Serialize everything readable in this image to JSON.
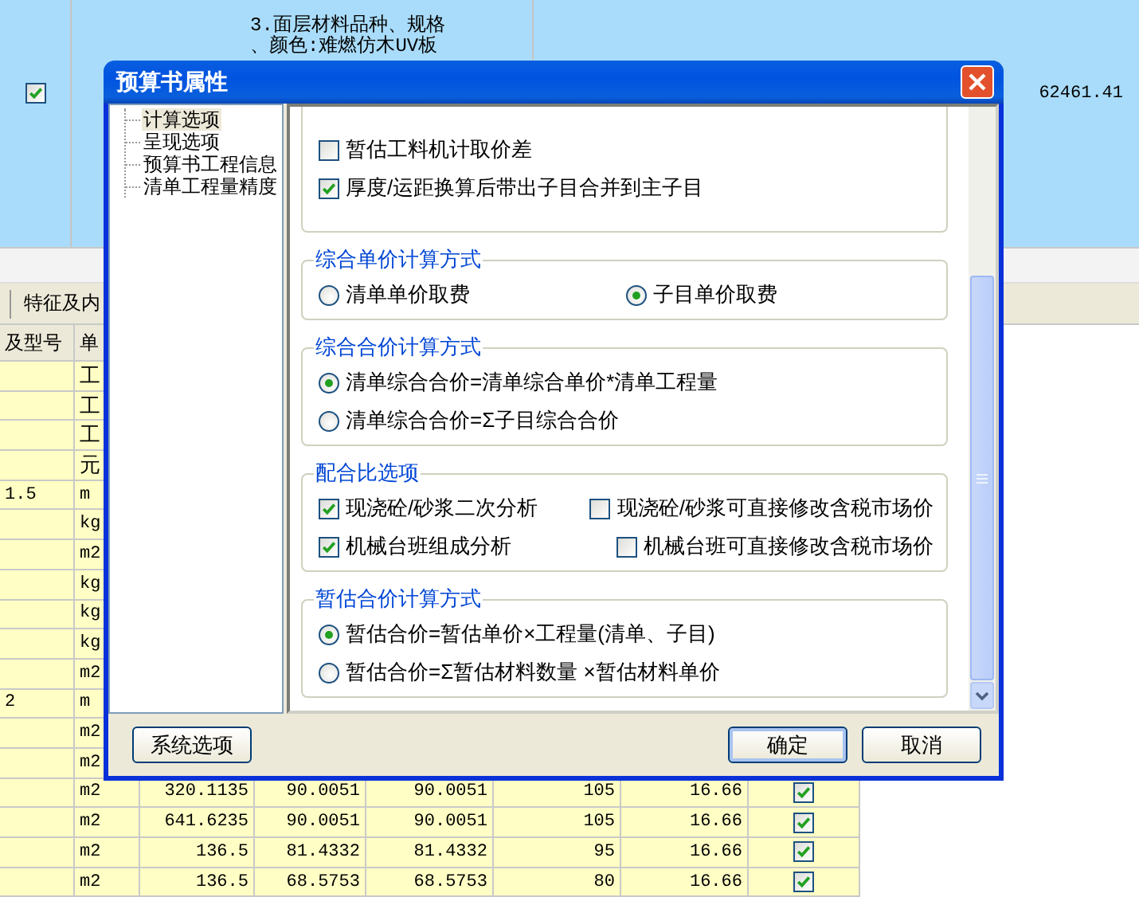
{
  "background": {
    "top_row": {
      "checked": true,
      "description": [
        "3.面层材料品种、规格",
        "、颜色:难燃仿木UV板"
      ],
      "amount": "62461.41"
    },
    "toolbar_tab": "特征及内",
    "table": {
      "columns": [
        "及型号",
        "单"
      ],
      "rows": [
        {
          "unit": "工"
        },
        {
          "unit": "工"
        },
        {
          "unit": "工"
        },
        {
          "unit": "元"
        },
        {
          "spec": "1.5",
          "unit": "m"
        },
        {
          "unit": "kg"
        },
        {
          "unit": "m2"
        },
        {
          "unit": "kg"
        },
        {
          "unit": "kg"
        },
        {
          "unit": "kg"
        },
        {
          "unit": "m2"
        },
        {
          "spec": "2",
          "unit": "m"
        },
        {
          "unit": "m2"
        },
        {
          "unit": "m2"
        },
        {
          "unit": "m2",
          "values": [
            "320.1135",
            "90.0051",
            "90.0051",
            "105",
            "16.66"
          ],
          "checked": true
        },
        {
          "unit": "m2",
          "values": [
            "641.6235",
            "90.0051",
            "90.0051",
            "105",
            "16.66"
          ],
          "checked": true
        },
        {
          "unit": "m2",
          "values": [
            "136.5",
            "81.4332",
            "81.4332",
            "95",
            "16.66"
          ],
          "checked": true
        },
        {
          "unit": "m2",
          "values": [
            "136.5",
            "68.5753",
            "68.5753",
            "80",
            "16.66"
          ],
          "checked": true
        }
      ]
    }
  },
  "dialog": {
    "title": "预算书属性",
    "tree": [
      {
        "label": "计算选项",
        "selected": true
      },
      {
        "label": "呈现选项",
        "selected": false
      },
      {
        "label": "预算书工程信息",
        "selected": false
      },
      {
        "label": "清单工程量精度",
        "selected": false
      }
    ],
    "groups": [
      {
        "kind": "checks",
        "rows": [
          [
            {
              "label": "暂估工料机计取价差",
              "checked": false
            }
          ],
          [
            {
              "label": "厚度/运距换算后带出子目合并到主子目",
              "checked": true
            }
          ]
        ]
      },
      {
        "kind": "radios",
        "title": "综合单价计算方式",
        "rows": [
          [
            {
              "label": "清单单价取费",
              "selected": false
            },
            {
              "label": "子目单价取费",
              "selected": true
            }
          ]
        ]
      },
      {
        "kind": "radios",
        "title": "综合合价计算方式",
        "rows": [
          [
            {
              "label": "清单综合合价=清单综合单价*清单工程量",
              "selected": true
            }
          ],
          [
            {
              "label": "清单综合合价=Σ子目综合合价",
              "selected": false
            }
          ]
        ]
      },
      {
        "kind": "checks",
        "title": "配合比选项",
        "rows": [
          [
            {
              "label": "现浇砼/砂浆二次分析",
              "checked": true
            },
            {
              "label": "现浇砼/砂浆可直接修改含税市场价",
              "checked": false
            }
          ],
          [
            {
              "label": "机械台班组成分析",
              "checked": true
            },
            {
              "label": "机械台班可直接修改含税市场价",
              "checked": false
            }
          ]
        ]
      },
      {
        "kind": "radios",
        "title": "暂估合价计算方式",
        "rows": [
          [
            {
              "label": "暂估合价=暂估单价×工程量(清单、子目)",
              "selected": true
            }
          ],
          [
            {
              "label": "暂估合价=Σ暂估材料数量 ×暂估材料单价",
              "selected": false
            }
          ]
        ]
      }
    ],
    "buttons": {
      "left": "系统选项",
      "ok": "确定",
      "cancel": "取消"
    }
  }
}
